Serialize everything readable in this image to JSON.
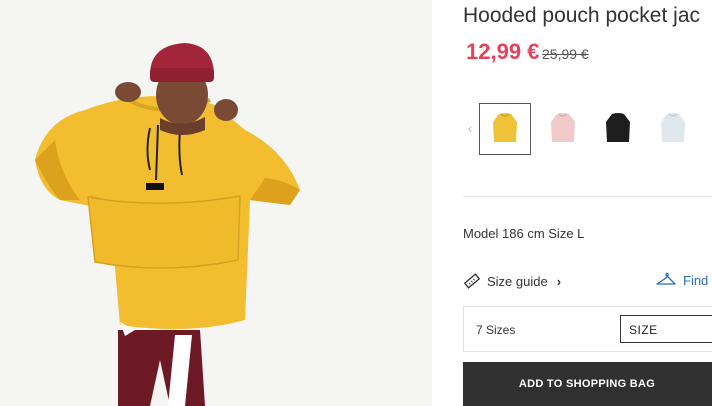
{
  "product": {
    "title": "Hooded pouch pocket jac",
    "price_current": "12,99 €",
    "price_original": "25,99 €"
  },
  "colors": {
    "sale": "#e8425b",
    "button_bg": "#303030",
    "link": "#2a6fb8"
  },
  "swatches": [
    {
      "name": "yellow",
      "color": "#f0c23a",
      "selected": true
    },
    {
      "name": "pink",
      "color": "#f1c9c9",
      "selected": false
    },
    {
      "name": "black",
      "color": "#1e1e1e",
      "selected": false
    },
    {
      "name": "light-blue",
      "color": "#dfe8ec",
      "selected": false
    }
  ],
  "model_info": "Model 186 cm Size L",
  "size_guide": {
    "label": "Size guide",
    "icon": "ruler-icon"
  },
  "find_size": {
    "label": "Find",
    "icon": "hanger-icon"
  },
  "size_selector": {
    "count_text": "7 Sizes",
    "placeholder": "SIZE"
  },
  "add_to_bag": {
    "label": "ADD TO SHOPPING BAG"
  }
}
